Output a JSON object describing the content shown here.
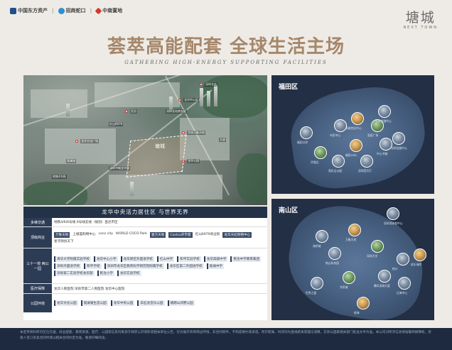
{
  "header": {
    "logos": [
      "中国东方资产",
      "招商蛇口",
      "中南置地"
    ],
    "brand_cn": "塘城",
    "brand_en": "NEXT TOWN",
    "title": "荟萃高能配套 全球生活主场",
    "subtitle": "GATHERING HIGH-ENERGY SUPPORTING FACILITIES"
  },
  "aerial": {
    "site_label": "塘城",
    "labels": [
      "深圳北站",
      "龙华中心区",
      "民治",
      "深圳北站商务区",
      "红山6979",
      "华润万象天地",
      "龙华文化广场",
      "大浪",
      "观澜湖",
      "龙华公园",
      "深圳书城龙华城",
      "地铁4号线"
    ]
  },
  "table": {
    "heading": "龙华中央活力居住区 与世界无界",
    "rows": [
      {
        "label": "多维交通",
        "items": [
          {
            "text": "地铁4/6/6号线 6号线支线（规划）直达市区",
            "style": "plain"
          }
        ]
      },
      {
        "label": "顶级商业",
        "items": [
          {
            "text": "万象天地",
            "style": "chip"
          },
          {
            "text": "上塘荟购物中心",
            "style": "plain"
          },
          {
            "text": "coco city",
            "style": "plain"
          },
          {
            "text": "WORLD COCO Park",
            "style": "plain"
          },
          {
            "text": "壹方天地",
            "style": "chip"
          },
          {
            "text": "Costco开市客",
            "style": "chip"
          },
          {
            "text": "红山6979商业街",
            "style": "plain"
          },
          {
            "text": "龙华天虹购物中心",
            "style": "chip"
          },
          {
            "text": "星河领创天下",
            "style": "plain"
          }
        ]
      },
      {
        "label": "三十一校 两公一园",
        "items": [
          {
            "text": "清华大学附属实验学校",
            "style": "chip light"
          },
          {
            "text": "龙华中心小学",
            "style": "chip light"
          },
          {
            "text": "龙华新区外国语学校",
            "style": "chip light"
          },
          {
            "text": "红山中学",
            "style": "chip light"
          },
          {
            "text": "和平实验学校",
            "style": "chip light"
          },
          {
            "text": "龙华高级中学",
            "style": "chip light"
          },
          {
            "text": "民治中学教育集团",
            "style": "chip light"
          },
          {
            "text": "深圳外国语学校",
            "style": "chip light"
          },
          {
            "text": "和平学校",
            "style": "chip light"
          },
          {
            "text": "深圳市龙华区教育科学研究院附属学校",
            "style": "chip light"
          },
          {
            "text": "龙华区第二外国语学校",
            "style": "chip light"
          },
          {
            "text": "观澜中学",
            "style": "chip light"
          },
          {
            "text": "深圳第二实验学校龙华部",
            "style": "chip light"
          },
          {
            "text": "民治小学",
            "style": "chip light"
          },
          {
            "text": "龙华实验学校",
            "style": "chip light"
          }
        ]
      },
      {
        "label": "医疗保障",
        "items": [
          {
            "text": "龙华人民医院 深圳市第二人民医院 龙华中心医院",
            "style": "plain"
          }
        ]
      },
      {
        "label": "公园环绕",
        "items": [
          {
            "text": "龙华文化公园",
            "style": "chip light"
          },
          {
            "text": "观澜湖生态公园",
            "style": "chip light"
          },
          {
            "text": "龙华中央公园",
            "style": "chip light"
          },
          {
            "text": "白石龙音乐公园",
            "style": "chip light"
          },
          {
            "text": "塘朗山郊野公园",
            "style": "chip light"
          }
        ]
      }
    ]
  },
  "futian": {
    "title": "福田区",
    "pois": [
      "平安金融中心",
      "卓越世纪中心",
      "市民中心",
      "深圳会展中心",
      "华强北",
      "莲花山公园",
      "福田CBD",
      "深圳音乐厅",
      "中心书城",
      "皇庭广场",
      "福田口岸"
    ]
  },
  "nanshan": {
    "title": "南山区",
    "pois": [
      "深圳湾体育中心",
      "万象天地",
      "海岸城",
      "南山科技园",
      "深圳大学",
      "蛇口",
      "欢乐海岸",
      "世界之窗",
      "华侨城",
      "腾讯滨海大厦",
      "后海中心",
      "前海"
    ]
  },
  "footer": {
    "text": "本宣传资料所示区位交通、商业配套、教育资源、医疗、公园等信息均来源于政府公开资料或相关单位公告，仅为展示项目周边环境，非合同附件，不构成要约或承诺。所示距离、时间均为直线距离或理论测算，实际以国家相关部门批准文件为准。本公司对所涉信息保留最终解释权，买受人签订买卖合同时请以相关合同约定为准，敬请仔细阅读。"
  },
  "colors": {
    "title_gold": "#a6876a",
    "navy": "#222f45",
    "footer_navy": "#1d2a40"
  }
}
